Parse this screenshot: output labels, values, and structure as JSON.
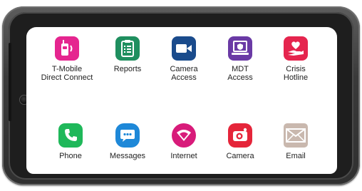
{
  "apps_row1": [
    {
      "label_line1": "T-Mobile",
      "label_line2": "Direct Connect",
      "icon": "walkie-talkie-icon",
      "color": "#e5258f"
    },
    {
      "label_line1": "Reports",
      "label_line2": "",
      "icon": "clipboard-icon",
      "color": "#1f8f5f"
    },
    {
      "label_line1": "Camera",
      "label_line2": "Access",
      "icon": "video-camera-icon",
      "color": "#1a4b8c"
    },
    {
      "label_line1": "MDT",
      "label_line2": "Access",
      "icon": "laptop-shield-icon",
      "color": "#6a3aa5"
    },
    {
      "label_line1": "Crisis",
      "label_line2": "Hotline",
      "icon": "heart-hand-icon",
      "color": "#e5254e"
    }
  ],
  "apps_row2": [
    {
      "label": "Phone",
      "icon": "phone-icon",
      "color": "#1fb85a"
    },
    {
      "label": "Messages",
      "icon": "message-bubble-icon",
      "color": "#1e88d8"
    },
    {
      "label": "Internet",
      "icon": "internet-planet-icon",
      "color": "#d81b7a"
    },
    {
      "label": "Camera",
      "icon": "camera-icon",
      "color": "#e5253a"
    },
    {
      "label": "Email",
      "icon": "envelope-icon",
      "color": "#c9b8ae"
    }
  ]
}
